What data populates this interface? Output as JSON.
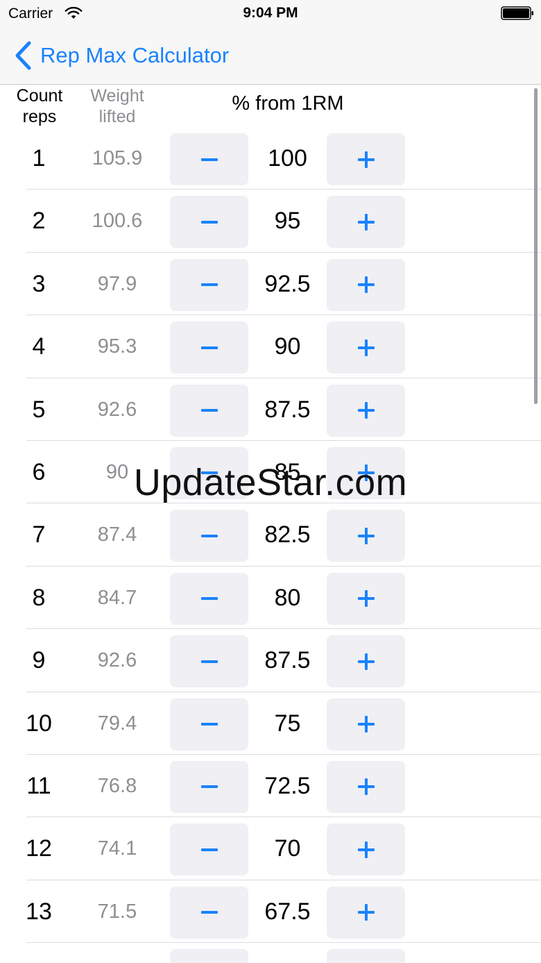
{
  "status_bar": {
    "carrier": "Carrier",
    "time": "9:04 PM",
    "icons": [
      "wifi-icon",
      "battery-icon"
    ]
  },
  "nav": {
    "back_label": "Rep Max Calculator",
    "back_icon": "chevron-left-icon"
  },
  "headers": {
    "reps_line1": "Count",
    "reps_line2": "reps",
    "weight_line1": "Weight",
    "weight_line2": "lifted",
    "percent": "% from 1RM"
  },
  "stepper": {
    "minus_icon": "minus-icon",
    "plus_icon": "plus-icon"
  },
  "rows": [
    {
      "reps": "1",
      "weight": "105.9",
      "percent": "100"
    },
    {
      "reps": "2",
      "weight": "100.6",
      "percent": "95"
    },
    {
      "reps": "3",
      "weight": "97.9",
      "percent": "92.5"
    },
    {
      "reps": "4",
      "weight": "95.3",
      "percent": "90"
    },
    {
      "reps": "5",
      "weight": "92.6",
      "percent": "87.5"
    },
    {
      "reps": "6",
      "weight": "90",
      "percent": "85"
    },
    {
      "reps": "7",
      "weight": "87.4",
      "percent": "82.5"
    },
    {
      "reps": "8",
      "weight": "84.7",
      "percent": "80"
    },
    {
      "reps": "9",
      "weight": "92.6",
      "percent": "87.5"
    },
    {
      "reps": "10",
      "weight": "79.4",
      "percent": "75"
    },
    {
      "reps": "11",
      "weight": "76.8",
      "percent": "72.5"
    },
    {
      "reps": "12",
      "weight": "74.1",
      "percent": "70"
    },
    {
      "reps": "13",
      "weight": "71.5",
      "percent": "67.5"
    },
    {
      "reps": "",
      "weight": "",
      "percent": ""
    }
  ],
  "watermark": "UpdateStar.com",
  "colors": {
    "accent": "#1a82fb",
    "secondary_text": "#8e8e93",
    "button_bg": "#efeff4",
    "bar_bg": "#f7f7f7"
  }
}
